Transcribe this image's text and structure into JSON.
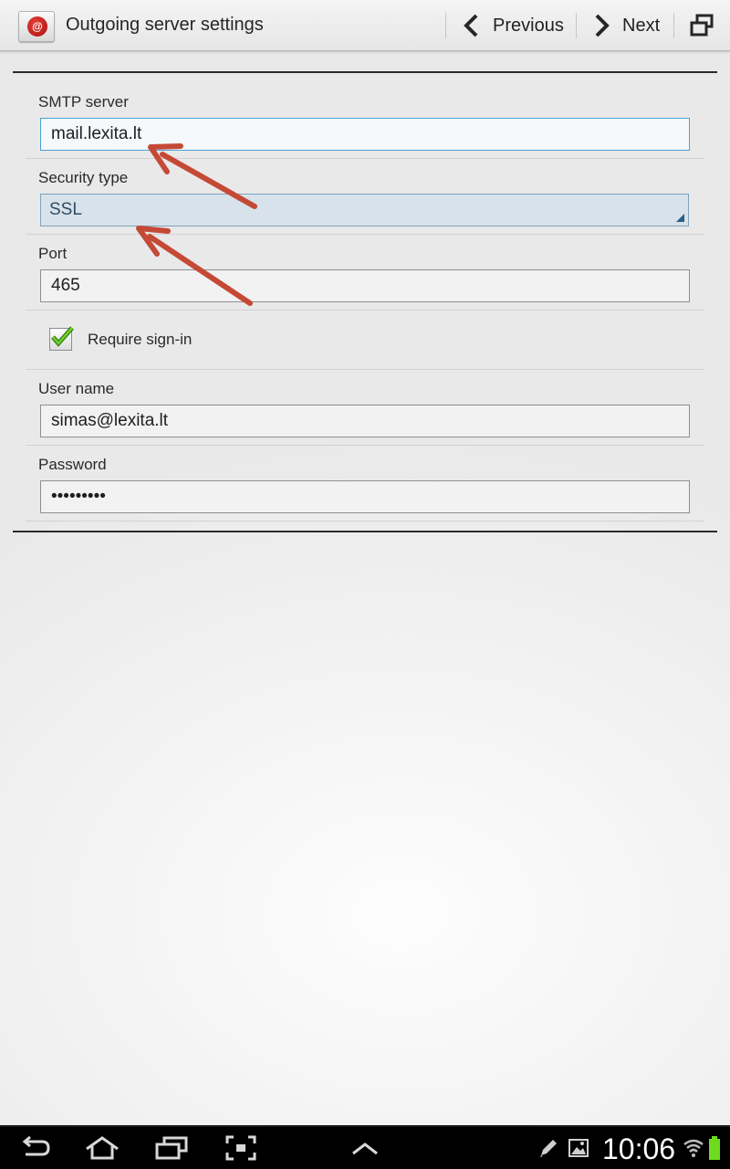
{
  "actionbar": {
    "title": "Outgoing server settings",
    "previous_label": "Previous",
    "next_label": "Next"
  },
  "form": {
    "smtp_label": "SMTP server",
    "smtp_value": "mail.lexita.lt",
    "security_label": "Security type",
    "security_value": "SSL",
    "port_label": "Port",
    "port_value": "465",
    "require_signin_label": "Require sign-in",
    "require_signin_checked": true,
    "username_label": "User name",
    "username_value": "simas@lexita.lt",
    "password_label": "Password",
    "password_value": "•••••••••"
  },
  "statusbar": {
    "time": "10:06",
    "battery_level": 1.0
  },
  "colors": {
    "annotation_arrow": "#c44a36",
    "focus_border": "#4da0d6",
    "checkmark": "#4caf1a",
    "battery": "#6ddc1e"
  }
}
